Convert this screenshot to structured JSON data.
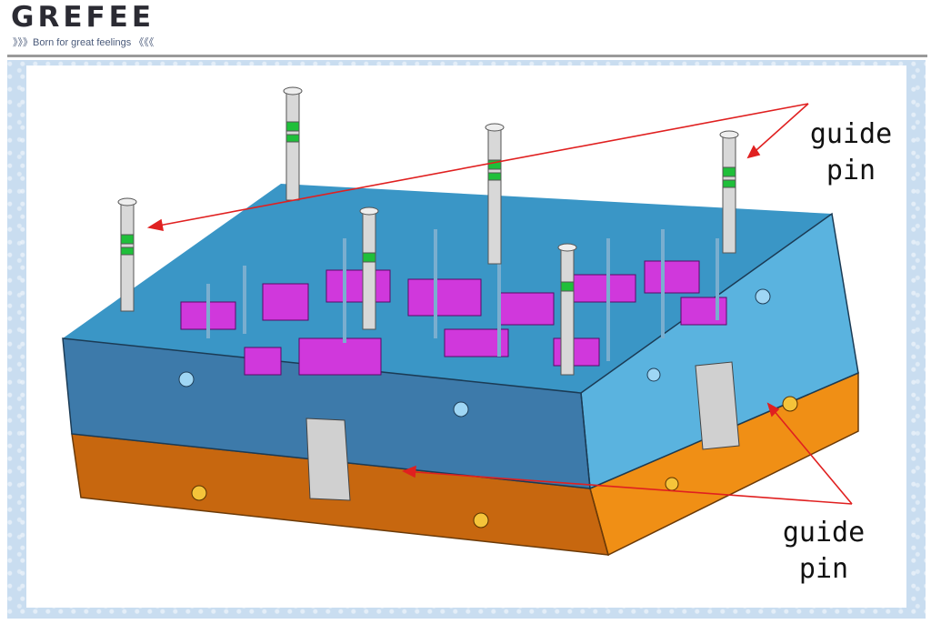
{
  "header": {
    "logo": "GREFEE",
    "tagline": "》》》Born for great feelings 《《《"
  },
  "annotations": {
    "top_label": [
      "guide",
      "pin"
    ],
    "bottom_label": [
      "guide",
      "pin"
    ]
  },
  "colors": {
    "top_plate": "#4a8fbf",
    "top_plate_face": "#5aa8d4",
    "bottom_plate": "#e8901a",
    "bottom_plate_side": "#c76e12",
    "pins": "#c8c8c8",
    "pin_rings": "#1fbf3a",
    "inserts": "#d43adf",
    "arrows": "#e02020"
  }
}
